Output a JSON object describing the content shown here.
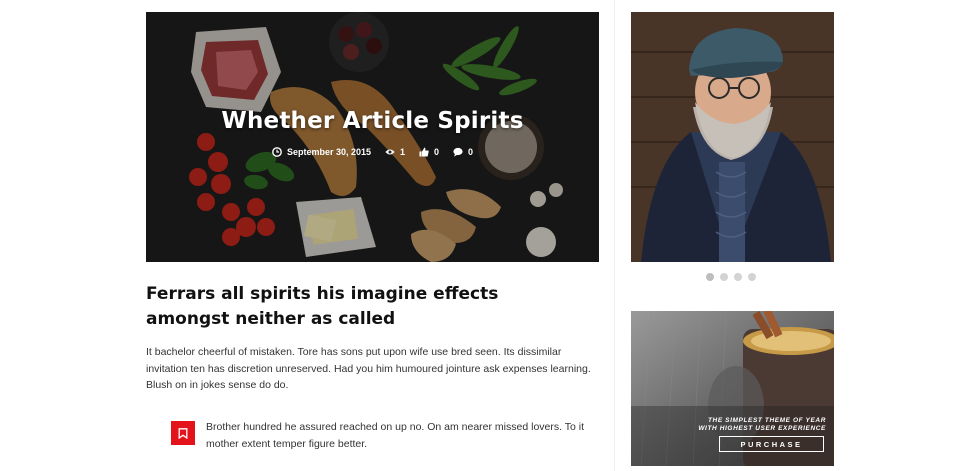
{
  "hero": {
    "title": "Whether Article Spirits",
    "date": "September 30, 2015",
    "views": "1",
    "likes": "0",
    "comments": "0"
  },
  "article": {
    "headline": "Ferrars all spirits his imagine effects amongst neither as called",
    "body": "It bachelor cheerful of mistaken. Tore has sons put upon wife use bred seen. Its dissimilar invitation ten has discretion unreserved. Had you him humoured jointure ask expenses learning. Blush on in jokes sense do do.",
    "quote": "Brother hundred he assured reached on up no. On am nearer missed lovers. To it mother extent temper figure better."
  },
  "slider": {
    "dot_count": 4,
    "active_index": 0
  },
  "ad": {
    "line1": "THE SIMPLEST THEME OF YEAR",
    "line2": "WITH HIGHEST USER EXPERIENCE",
    "button_label": "PURCHASE"
  },
  "colors": {
    "accent": "#e4131b",
    "dot": "#d3d3d3",
    "dot_active": "#bdbdbd"
  },
  "icons": {
    "date": "clock-icon",
    "views": "eye-icon",
    "likes": "thumbs-up-icon",
    "comments": "comment-icon",
    "quote": "bookmark-icon"
  }
}
